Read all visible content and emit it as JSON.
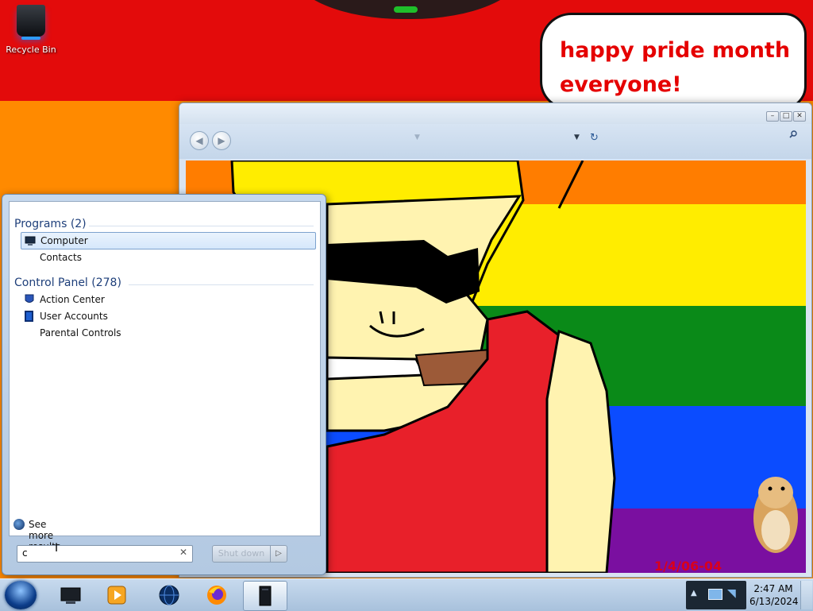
{
  "desktop": {
    "icons": [
      {
        "label": "Recycle Bin",
        "icon": "recycle-bin-icon"
      }
    ],
    "wallpaper_text": "happy pride month\neveryone!",
    "colors": {
      "red": "#e30b0b",
      "orange": "#ff8a00",
      "text_red": "#e50000"
    }
  },
  "explorer": {
    "caption_buttons": {
      "minimize": "–",
      "maximize": "□",
      "close": "✕"
    },
    "nav": {
      "back": "◀",
      "forward": "▶",
      "dropdown": "▼",
      "address_dropdown": "▼",
      "refresh": "↻"
    },
    "image_caption": "1/4/06-04"
  },
  "start_menu": {
    "groups": [
      {
        "title": "Programs (2)",
        "items": [
          {
            "label": "Computer",
            "icon": "computer-icon",
            "selected": true
          },
          {
            "label": "Contacts",
            "icon": ""
          }
        ]
      },
      {
        "title": "Control Panel (278)",
        "items": [
          {
            "label": "Action Center",
            "icon": "flag-shield-icon"
          },
          {
            "label": "User Accounts",
            "icon": "user-accounts-icon"
          },
          {
            "label": "Parental Controls",
            "icon": ""
          }
        ]
      }
    ],
    "see_more": "See more results",
    "search": {
      "value": "c",
      "clear": "✕"
    },
    "shutdown": {
      "label": "Shut down",
      "arrow": "▷"
    }
  },
  "taskbar": {
    "pinned": [
      {
        "name": "explorer-app",
        "icon": "monitor-icon"
      },
      {
        "name": "media-player-app",
        "icon": "media-player-icon"
      },
      {
        "name": "browser-app",
        "icon": "globe-icon"
      },
      {
        "name": "firefox-app",
        "icon": "firefox-icon"
      },
      {
        "name": "active-window-app",
        "icon": "tower-icon",
        "active": true
      }
    ],
    "tray_overflow": "▲",
    "clock": {
      "time": "2:47 AM",
      "date": "6/13/2024"
    }
  }
}
